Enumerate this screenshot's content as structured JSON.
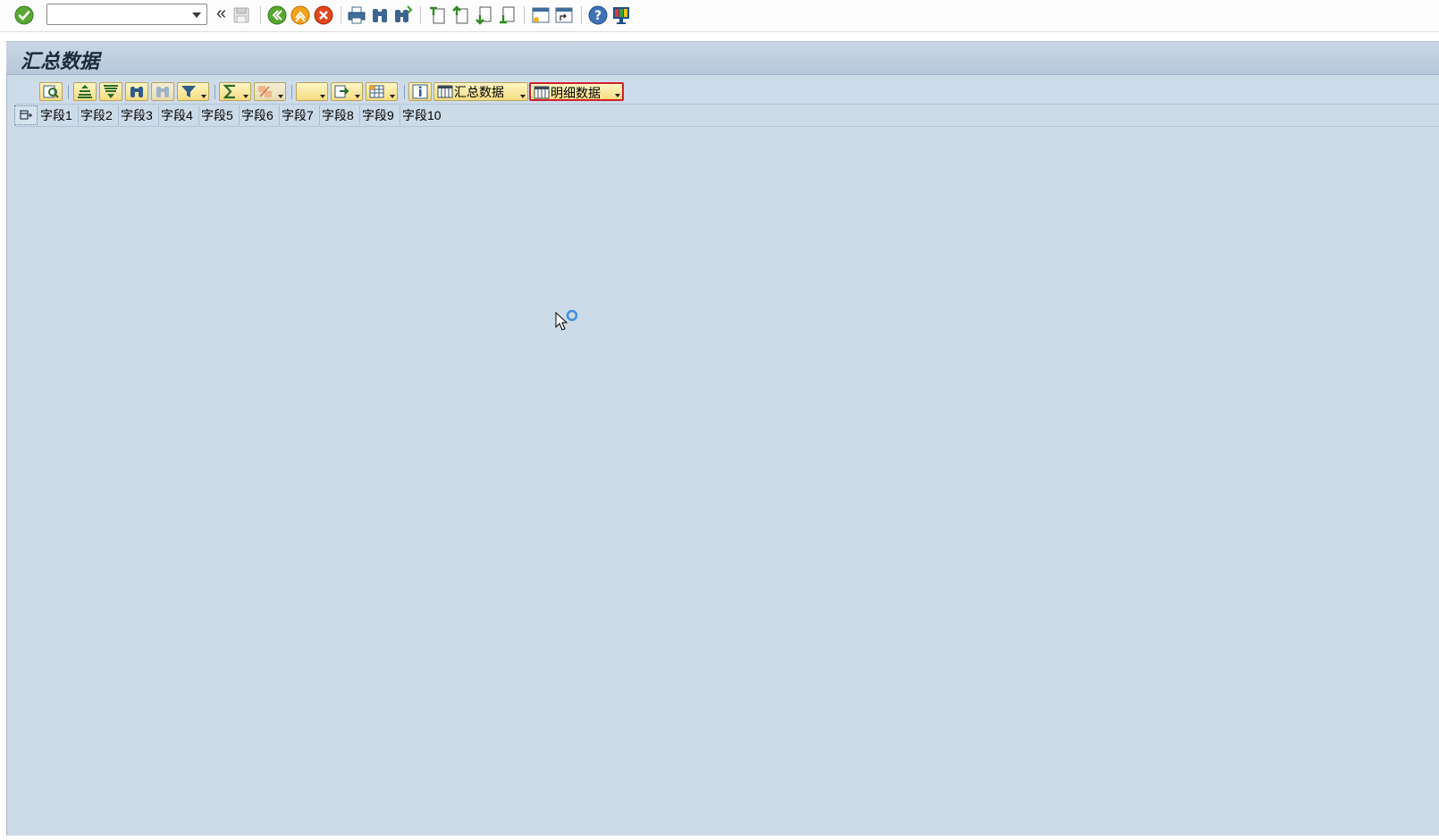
{
  "system_toolbar": {
    "command_field": {
      "value": "",
      "placeholder": ""
    },
    "icons": [
      "enter-icon",
      "back-double-chevron-icon",
      "save-icon",
      "back-icon",
      "exit-icon",
      "cancel-icon",
      "print-icon",
      "find-icon",
      "find-next-icon",
      "first-page-icon",
      "previous-page-icon",
      "next-page-icon",
      "last-page-icon",
      "create-session-icon",
      "shortcut-icon",
      "help-icon",
      "customize-layout-icon"
    ],
    "back_glyph": "«"
  },
  "title": "汇总数据",
  "alv_toolbar": {
    "buttons": [
      "details",
      "sort-ascending",
      "sort-descending",
      "find",
      "find-next",
      "filter",
      "sum",
      "subtotals",
      "print-preview",
      "export",
      "change-layout",
      "information"
    ],
    "summary_button_label": "汇总数据",
    "detail_button_label": "明细数据"
  },
  "table": {
    "columns": [
      "字段1",
      "字段2",
      "字段3",
      "字段4",
      "字段5",
      "字段6",
      "字段7",
      "字段8",
      "字段9",
      "字段10"
    ],
    "rows": []
  },
  "colors": {
    "content_bg": "#ccdbe8",
    "title_bg": "#b6c8da",
    "button_bg": "#f5dc82",
    "selected_border": "#d0202a"
  }
}
